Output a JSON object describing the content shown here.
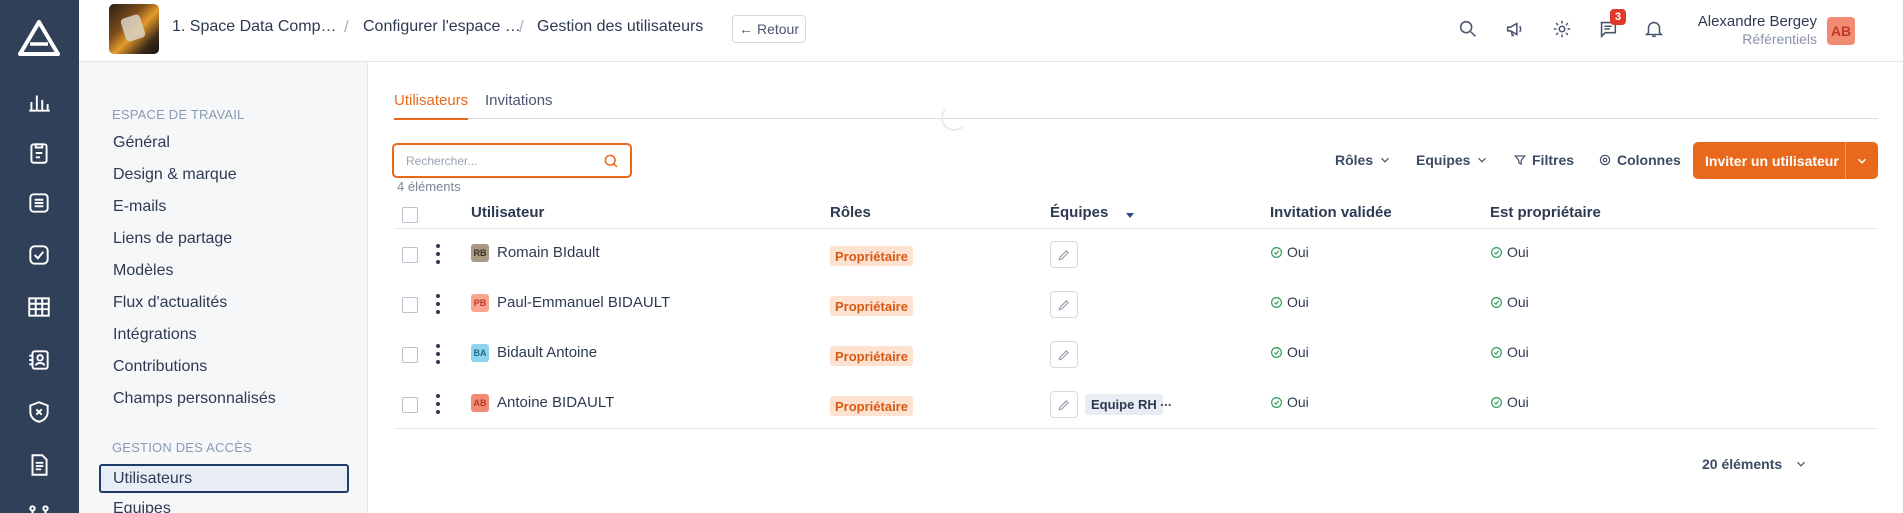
{
  "header": {
    "breadcrumbs": [
      "1. Space Data Comp…",
      "Configurer l'espace …",
      "Gestion des utilisateurs"
    ],
    "back_label": "Retour",
    "notification_count": "3",
    "user": {
      "name": "Alexandre Bergey",
      "subtitle": "Référentiels",
      "initials": "AB"
    }
  },
  "rail": {
    "icons": [
      "logo-icon",
      "chart-icon",
      "clipboard-icon",
      "stack-icon",
      "checklist-icon",
      "table-icon",
      "badge-icon",
      "shield-icon",
      "document-icon",
      "network-icon"
    ]
  },
  "sidebar": {
    "workspace_section": "ESPACE DE TRAVAIL",
    "workspace_items": [
      "Général",
      "Design & marque",
      "E-mails",
      "Liens de partage",
      "Modèles",
      "Flux d'actualités",
      "Intégrations",
      "Contributions",
      "Champs personnalisés"
    ],
    "access_section": "GESTION DES ACCÈS",
    "access_items": [
      "Utilisateurs",
      "Equipes"
    ],
    "active_item": "Utilisateurs"
  },
  "tabs": [
    "Utilisateurs",
    "Invitations"
  ],
  "search": {
    "placeholder": "Rechercher...",
    "value": ""
  },
  "elements_count_top": "4 éléments",
  "toolbar": {
    "roles": "Rôles",
    "teams": "Equipes",
    "filters": "Filtres",
    "columns": "Colonnes",
    "invite": "Inviter un utilisateur"
  },
  "table": {
    "columns": [
      "Utilisateur",
      "Rôles",
      "Équipes",
      "Invitation validée",
      "Est propriétaire"
    ],
    "rows": [
      {
        "initials": "RB",
        "avatar_bg": "#a89a84",
        "avatar_fg": "#3b3020",
        "name": "Romain BIdault",
        "role": "Propriétaire",
        "team": "",
        "team_more": "",
        "invitation": "Oui",
        "owner": "Oui"
      },
      {
        "initials": "PB",
        "avatar_bg": "#f7a58e",
        "avatar_fg": "#c0392b",
        "name": "Paul-Emmanuel BIDAULT",
        "role": "Propriétaire",
        "team": "",
        "team_more": "",
        "invitation": "Oui",
        "owner": "Oui"
      },
      {
        "initials": "BA",
        "avatar_bg": "#8fd3ec",
        "avatar_fg": "#1b6f90",
        "name": "Bidault Antoine",
        "role": "Propriétaire",
        "team": "",
        "team_more": "",
        "invitation": "Oui",
        "owner": "Oui"
      },
      {
        "initials": "AB",
        "avatar_bg": "#f28b73",
        "avatar_fg": "#c0392b",
        "name": "Antoine BIDAULT",
        "role": "Propriétaire",
        "team": "Equipe RH",
        "team_more": "...",
        "invitation": "Oui",
        "owner": "Oui"
      }
    ]
  },
  "footer": {
    "page_size": "20 éléments"
  },
  "colors": {
    "accent": "#e8691b",
    "rail": "#2f4058",
    "success": "#2e9e5b"
  }
}
